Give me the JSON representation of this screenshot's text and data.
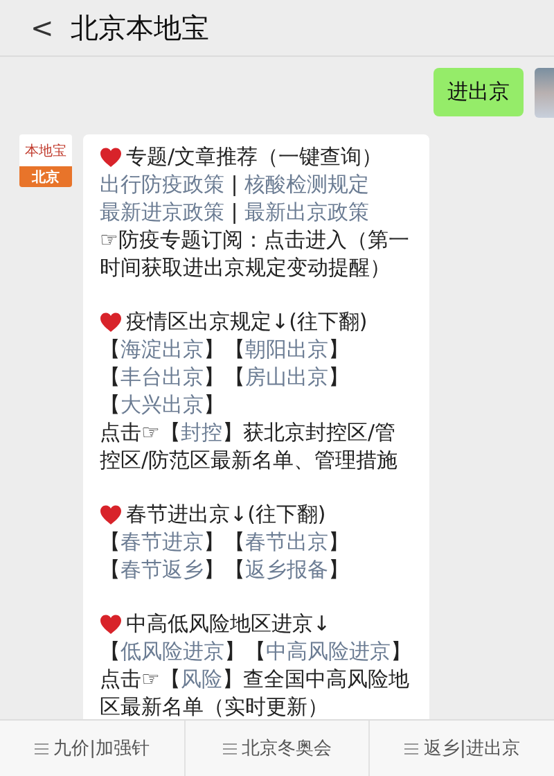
{
  "header": {
    "back": "<",
    "title": "北京本地宝"
  },
  "sent": {
    "text": "进出京"
  },
  "account_logo": {
    "top": "本地宝",
    "bottom": "北京"
  },
  "sections": [
    {
      "title": "专题/文章推荐（一键查询）",
      "paragraphs": [
        [
          {
            "kind": "link",
            "text": "出行防疫政策"
          },
          {
            "kind": "text",
            "text": " | "
          },
          {
            "kind": "link",
            "text": "核酸检测规定"
          }
        ],
        [
          {
            "kind": "link",
            "text": "最新进京政策"
          },
          {
            "kind": "text",
            "text": " | "
          },
          {
            "kind": "link",
            "text": "最新出京政策"
          }
        ],
        [
          {
            "kind": "text",
            "text": "☞防疫专题订阅：点击进入（第一时间获取进出京规定变动提醒）"
          }
        ]
      ]
    },
    {
      "title": "疫情区出京规定↓(往下翻)",
      "paragraphs": [
        [
          {
            "kind": "text",
            "text": "【"
          },
          {
            "kind": "link",
            "text": "海淀出京"
          },
          {
            "kind": "text",
            "text": "】【"
          },
          {
            "kind": "link",
            "text": "朝阳出京"
          },
          {
            "kind": "text",
            "text": "】"
          }
        ],
        [
          {
            "kind": "text",
            "text": "【"
          },
          {
            "kind": "link",
            "text": "丰台出京"
          },
          {
            "kind": "text",
            "text": "】【"
          },
          {
            "kind": "link",
            "text": "房山出京"
          },
          {
            "kind": "text",
            "text": "】"
          }
        ],
        [
          {
            "kind": "text",
            "text": "【"
          },
          {
            "kind": "link",
            "text": "大兴出京"
          },
          {
            "kind": "text",
            "text": "】"
          }
        ],
        [
          {
            "kind": "text",
            "text": "点击☞【"
          },
          {
            "kind": "link",
            "text": "封控"
          },
          {
            "kind": "text",
            "text": "】获北京封控区/管控区/防范区最新名单、管理措施"
          }
        ]
      ]
    },
    {
      "title": "春节进出京↓(往下翻)",
      "paragraphs": [
        [
          {
            "kind": "text",
            "text": "【"
          },
          {
            "kind": "link",
            "text": "春节进京"
          },
          {
            "kind": "text",
            "text": "】【"
          },
          {
            "kind": "link",
            "text": "春节出京"
          },
          {
            "kind": "text",
            "text": "】"
          }
        ],
        [
          {
            "kind": "text",
            "text": "【"
          },
          {
            "kind": "link",
            "text": "春节返乡"
          },
          {
            "kind": "text",
            "text": "】【"
          },
          {
            "kind": "link",
            "text": "返乡报备"
          },
          {
            "kind": "text",
            "text": "】"
          }
        ]
      ]
    },
    {
      "title": "中高低风险地区进京↓",
      "paragraphs": [
        [
          {
            "kind": "text",
            "text": "【"
          },
          {
            "kind": "link",
            "text": "低风险进京"
          },
          {
            "kind": "text",
            "text": "】【"
          },
          {
            "kind": "link",
            "text": "中高风险进京"
          },
          {
            "kind": "text",
            "text": "】"
          }
        ],
        [
          {
            "kind": "text",
            "text": "点击☞【"
          },
          {
            "kind": "link",
            "text": "风险"
          },
          {
            "kind": "text",
            "text": "】查全国中高风险地区最新名单（实时更新）"
          }
        ]
      ]
    }
  ],
  "menu": [
    "九价|加强针",
    "北京冬奥会",
    "返乡|进出京"
  ]
}
